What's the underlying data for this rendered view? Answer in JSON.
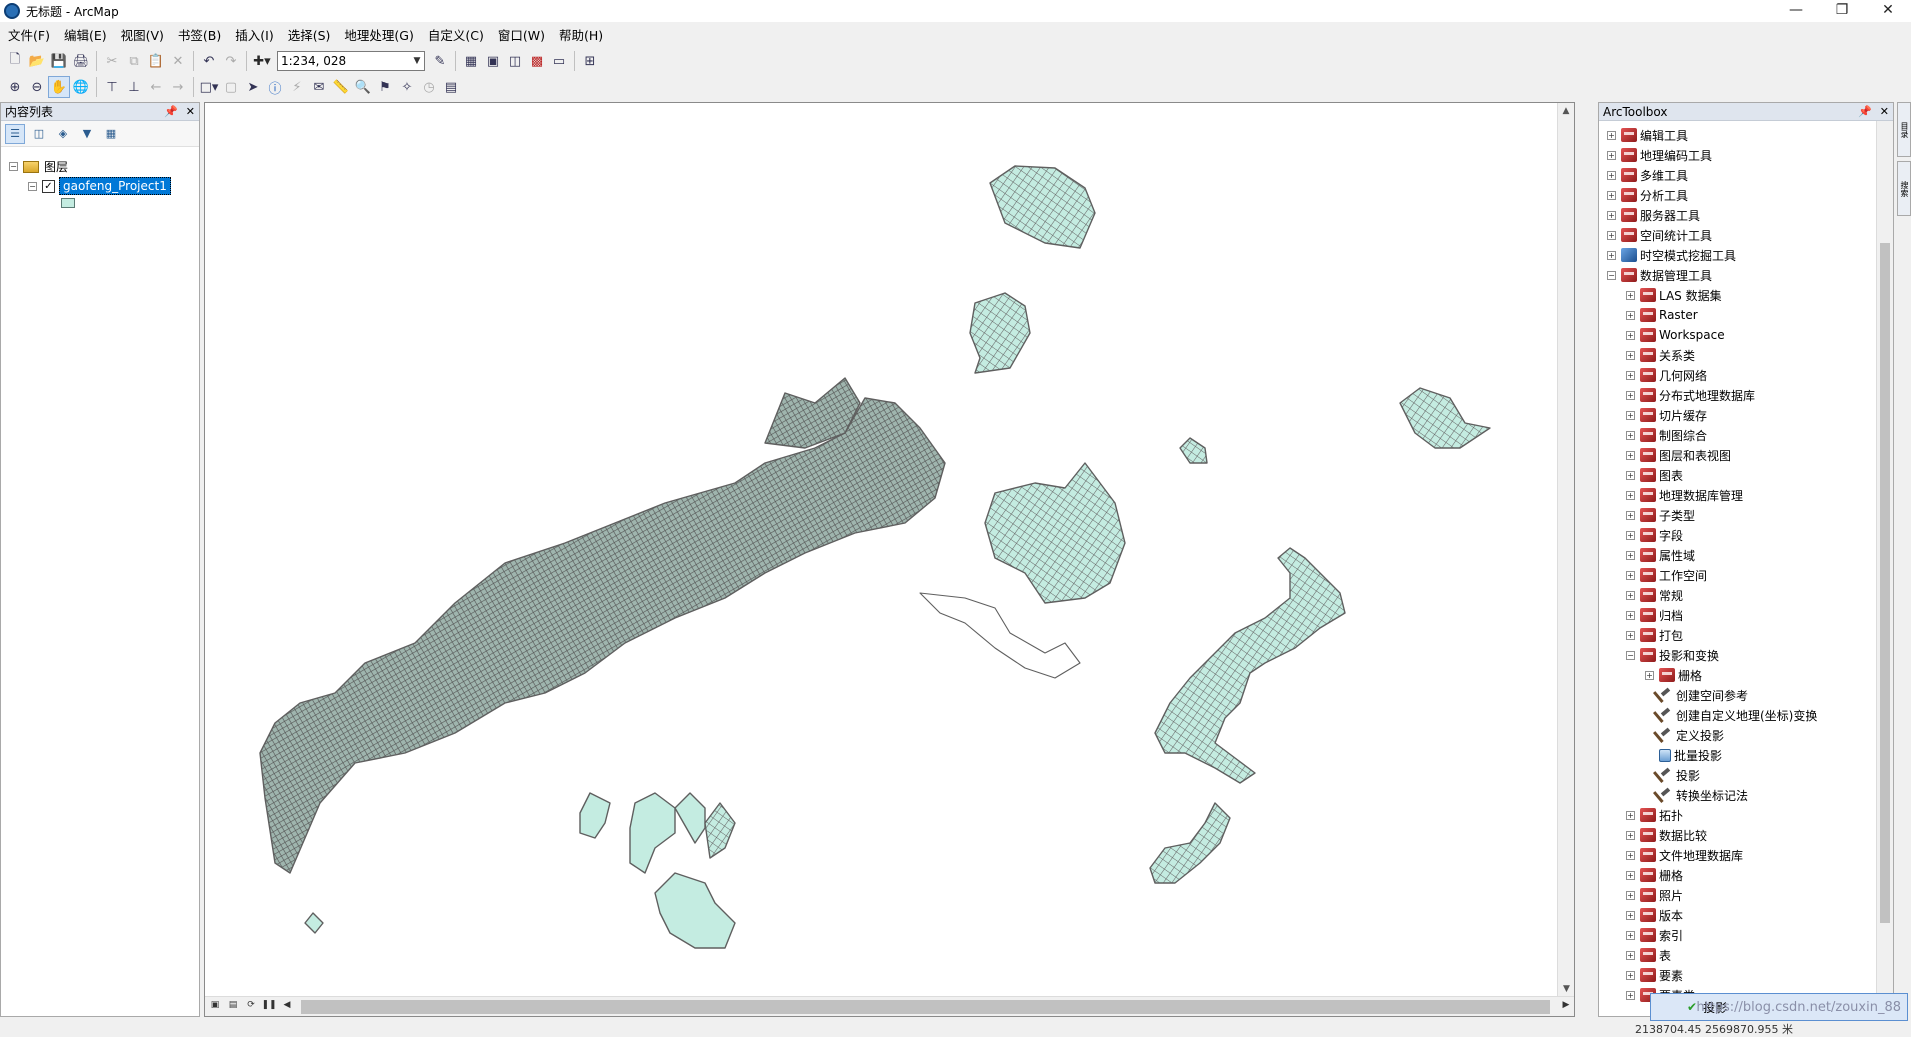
{
  "window": {
    "title": "无标题 - ArcMap"
  },
  "menu": [
    "文件(F)",
    "编辑(E)",
    "视图(V)",
    "书签(B)",
    "插入(I)",
    "选择(S)",
    "地理处理(G)",
    "自定义(C)",
    "窗口(W)",
    "帮助(H)"
  ],
  "toolbar": {
    "scale": "1:234, 028"
  },
  "toc": {
    "title": "内容列表",
    "root": "图层",
    "layer": "gaofeng_Project1"
  },
  "toolbox": {
    "title": "ArcToolbox",
    "items": [
      {
        "label": "编辑工具",
        "level": 0,
        "expander": "+",
        "icon": "red"
      },
      {
        "label": "地理编码工具",
        "level": 0,
        "expander": "+",
        "icon": "red"
      },
      {
        "label": "多维工具",
        "level": 0,
        "expander": "+",
        "icon": "red"
      },
      {
        "label": "分析工具",
        "level": 0,
        "expander": "+",
        "icon": "red"
      },
      {
        "label": "服务器工具",
        "level": 0,
        "expander": "+",
        "icon": "red"
      },
      {
        "label": "空间统计工具",
        "level": 0,
        "expander": "+",
        "icon": "red"
      },
      {
        "label": "时空模式挖掘工具",
        "level": 0,
        "expander": "+",
        "icon": "blue"
      },
      {
        "label": "数据管理工具",
        "level": 0,
        "expander": "−",
        "icon": "red"
      },
      {
        "label": "LAS 数据集",
        "level": 1,
        "expander": "+",
        "icon": "red"
      },
      {
        "label": "Raster",
        "level": 1,
        "expander": "+",
        "icon": "red"
      },
      {
        "label": "Workspace",
        "level": 1,
        "expander": "+",
        "icon": "red"
      },
      {
        "label": "关系类",
        "level": 1,
        "expander": "+",
        "icon": "red"
      },
      {
        "label": "几何网络",
        "level": 1,
        "expander": "+",
        "icon": "red"
      },
      {
        "label": "分布式地理数据库",
        "level": 1,
        "expander": "+",
        "icon": "red"
      },
      {
        "label": "切片缓存",
        "level": 1,
        "expander": "+",
        "icon": "red"
      },
      {
        "label": "制图综合",
        "level": 1,
        "expander": "+",
        "icon": "red"
      },
      {
        "label": "图层和表视图",
        "level": 1,
        "expander": "+",
        "icon": "red"
      },
      {
        "label": "图表",
        "level": 1,
        "expander": "+",
        "icon": "red"
      },
      {
        "label": "地理数据库管理",
        "level": 1,
        "expander": "+",
        "icon": "red"
      },
      {
        "label": "子类型",
        "level": 1,
        "expander": "+",
        "icon": "red"
      },
      {
        "label": "字段",
        "level": 1,
        "expander": "+",
        "icon": "red"
      },
      {
        "label": "属性域",
        "level": 1,
        "expander": "+",
        "icon": "red"
      },
      {
        "label": "工作空间",
        "level": 1,
        "expander": "+",
        "icon": "red"
      },
      {
        "label": "常规",
        "level": 1,
        "expander": "+",
        "icon": "red"
      },
      {
        "label": "归档",
        "level": 1,
        "expander": "+",
        "icon": "red"
      },
      {
        "label": "打包",
        "level": 1,
        "expander": "+",
        "icon": "red"
      },
      {
        "label": "投影和变换",
        "level": 1,
        "expander": "−",
        "icon": "red"
      },
      {
        "label": "栅格",
        "level": 2,
        "expander": "+",
        "icon": "red"
      },
      {
        "label": "创建空间参考",
        "level": 2,
        "expander": "",
        "icon": "tool"
      },
      {
        "label": "创建自定义地理(坐标)变换",
        "level": 2,
        "expander": "",
        "icon": "tool"
      },
      {
        "label": "定义投影",
        "level": 2,
        "expander": "",
        "icon": "tool"
      },
      {
        "label": "批量投影",
        "level": 2,
        "expander": "",
        "icon": "script"
      },
      {
        "label": "投影",
        "level": 2,
        "expander": "",
        "icon": "tool"
      },
      {
        "label": "转换坐标记法",
        "level": 2,
        "expander": "",
        "icon": "tool"
      },
      {
        "label": "拓扑",
        "level": 1,
        "expander": "+",
        "icon": "red"
      },
      {
        "label": "数据比较",
        "level": 1,
        "expander": "+",
        "icon": "red"
      },
      {
        "label": "文件地理数据库",
        "level": 1,
        "expander": "+",
        "icon": "red"
      },
      {
        "label": "栅格",
        "level": 1,
        "expander": "+",
        "icon": "red"
      },
      {
        "label": "照片",
        "level": 1,
        "expander": "+",
        "icon": "red"
      },
      {
        "label": "版本",
        "level": 1,
        "expander": "+",
        "icon": "red"
      },
      {
        "label": "索引",
        "level": 1,
        "expander": "+",
        "icon": "red"
      },
      {
        "label": "表",
        "level": 1,
        "expander": "+",
        "icon": "red"
      },
      {
        "label": "要素",
        "level": 1,
        "expander": "+",
        "icon": "red"
      },
      {
        "label": "要素类",
        "level": 1,
        "expander": "+",
        "icon": "red"
      }
    ]
  },
  "progress": {
    "label": "投影",
    "watermark": "https://blog.csdn.net/zouxin_88"
  },
  "status": {
    "coords": "2138704.45  2569870.955 米"
  },
  "colors": {
    "polygon_fill": "#c4ece1",
    "polygon_edge": "#5f5f5f",
    "selection": "#0078d7"
  }
}
